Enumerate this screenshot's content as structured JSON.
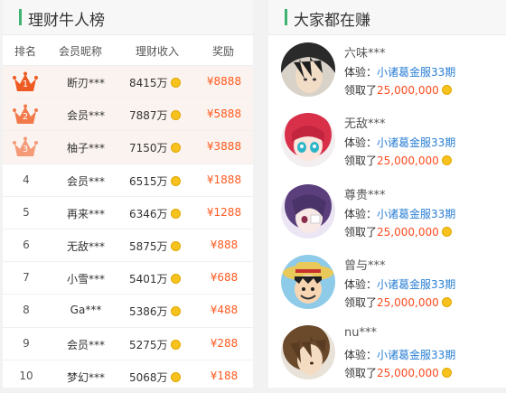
{
  "left_panel": {
    "title": "理财牛人榜",
    "columns": [
      "排名",
      "会员昵称",
      "理财收入",
      "奖励"
    ],
    "rows": [
      {
        "rank": "1",
        "name": "断刃***",
        "amount": "8415万",
        "reward": "¥8888"
      },
      {
        "rank": "2",
        "name": "会员***",
        "amount": "7887万",
        "reward": "¥5888"
      },
      {
        "rank": "3",
        "name": "柚子***",
        "amount": "7150万",
        "reward": "¥3888"
      },
      {
        "rank": "4",
        "name": "会员***",
        "amount": "6515万",
        "reward": "¥1888"
      },
      {
        "rank": "5",
        "name": "再来***",
        "amount": "6346万",
        "reward": "¥1288"
      },
      {
        "rank": "6",
        "name": "无敌***",
        "amount": "5875万",
        "reward": "¥888"
      },
      {
        "rank": "7",
        "name": "小雪***",
        "amount": "5401万",
        "reward": "¥688"
      },
      {
        "rank": "8",
        "name": "Ga***",
        "amount": "5386万",
        "reward": "¥488"
      },
      {
        "rank": "9",
        "name": "会员***",
        "amount": "5275万",
        "reward": "¥288"
      },
      {
        "rank": "10",
        "name": "梦幻***",
        "amount": "5068万",
        "reward": "¥188"
      }
    ],
    "crown_colors": [
      "#ee5a22",
      "#f27a4a",
      "#f59a76"
    ]
  },
  "right_panel": {
    "title": "大家都在赚",
    "exp_label": "体验：",
    "got_label": "领取了",
    "users": [
      {
        "name": "六味***",
        "product": "小诸葛金服33期",
        "amount": "25,000,000"
      },
      {
        "name": "无敌***",
        "product": "小诸葛金服33期",
        "amount": "25,000,000"
      },
      {
        "name": "尊贵***",
        "product": "小诸葛金服33期",
        "amount": "25,000,000"
      },
      {
        "name": "曾与***",
        "product": "小诸葛金服33期",
        "amount": "25,000,000"
      },
      {
        "name": "nu***",
        "product": "小诸葛金服33期",
        "amount": "25,000,000"
      }
    ]
  },
  "icons": {
    "coin": "gold-coin-icon",
    "crown": "crown-icon"
  },
  "accent": "#3cb371"
}
